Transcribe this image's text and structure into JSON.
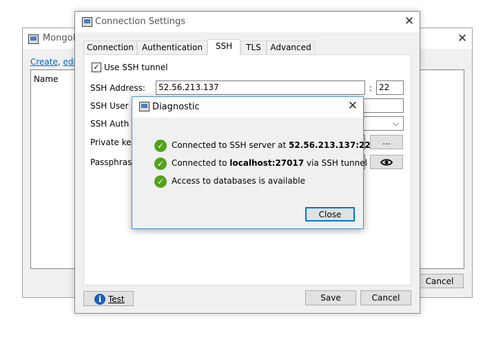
{
  "back_window": {
    "title": "MongoD",
    "links": {
      "create": "Create",
      "sep1": ", ",
      "edit": "edit",
      "sep2": ","
    },
    "list_header": "Name",
    "cancel_label": "Cancel"
  },
  "connection": {
    "title": "Connection Settings",
    "tabs": [
      "Connection",
      "Authentication",
      "SSH",
      "TLS",
      "Advanced"
    ],
    "active_tab": "SSH",
    "use_ssh_label": "Use SSH tunnel",
    "use_ssh_checked": true,
    "ssh_address_label": "SSH Address:",
    "ssh_address_value": "52.56.213.137",
    "colon": ":",
    "ssh_port_value": "22",
    "ssh_user_label": "SSH User Na",
    "ssh_auth_label": "SSH Auth Me",
    "private_key_label": "Private key:",
    "browse_label": "...",
    "passphrase_label": "Passphrase:",
    "test_label": "Test",
    "save_label": "Save",
    "cancel_label": "Cancel"
  },
  "diagnostic": {
    "title": "Diagnostic",
    "messages": [
      {
        "pre": "Connected to SSH server at ",
        "bold": "52.56.213.137:22",
        "post": ""
      },
      {
        "pre": "Connected to ",
        "bold": "localhost:27017",
        "post": " via SSH tunnel"
      },
      {
        "pre": "Access to databases is available",
        "bold": "",
        "post": ""
      }
    ],
    "close_label": "Close"
  },
  "colors": {
    "success": "#53a31b",
    "accent": "#0078d7",
    "info": "#1f5fb5"
  },
  "icons": [
    "app-window-icon",
    "close-icon",
    "checkbox-check-icon",
    "chevron-down-icon",
    "eye-icon",
    "info-icon",
    "success-check-icon"
  ]
}
